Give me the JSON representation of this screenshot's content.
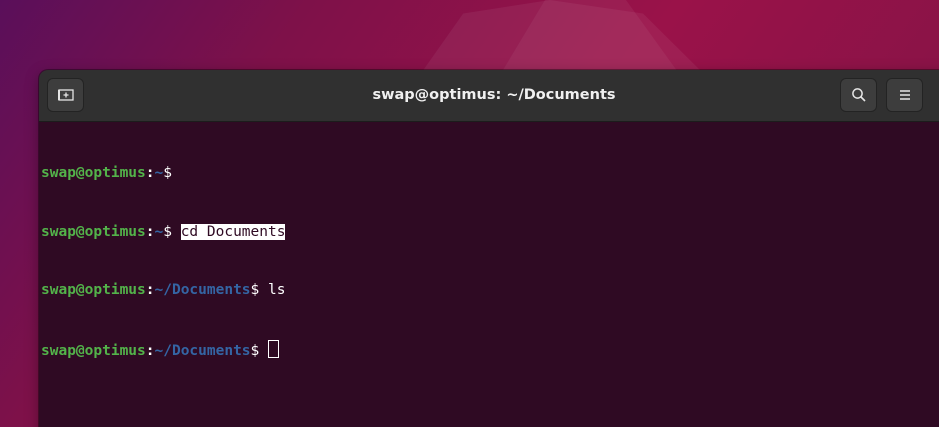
{
  "window": {
    "title": "swap@optimus: ~/Documents"
  },
  "titlebar": {
    "new_tab_icon": "new-tab-icon",
    "search_icon": "search-icon",
    "menu_icon": "hamburger-menu-icon"
  },
  "terminal": {
    "lines": [
      {
        "user_host": "swap@optimus",
        "sep": ":",
        "path": "~",
        "prompt": "$",
        "command": ""
      },
      {
        "user_host": "swap@optimus",
        "sep": ":",
        "path": "~",
        "prompt": "$ ",
        "command": "cd Documents"
      },
      {
        "user_host": "swap@optimus",
        "sep": ":",
        "path": "~/Documents",
        "prompt": "$ ",
        "command": "ls"
      },
      {
        "user_host": "swap@optimus",
        "sep": ":",
        "path": "~/Documents",
        "prompt": "$ ",
        "command": ""
      }
    ]
  },
  "colors": {
    "terminal_bg": "#2f0a23",
    "user_color": "#53b34a",
    "path_color": "#3465a4",
    "titlebar_bg": "#303030"
  }
}
